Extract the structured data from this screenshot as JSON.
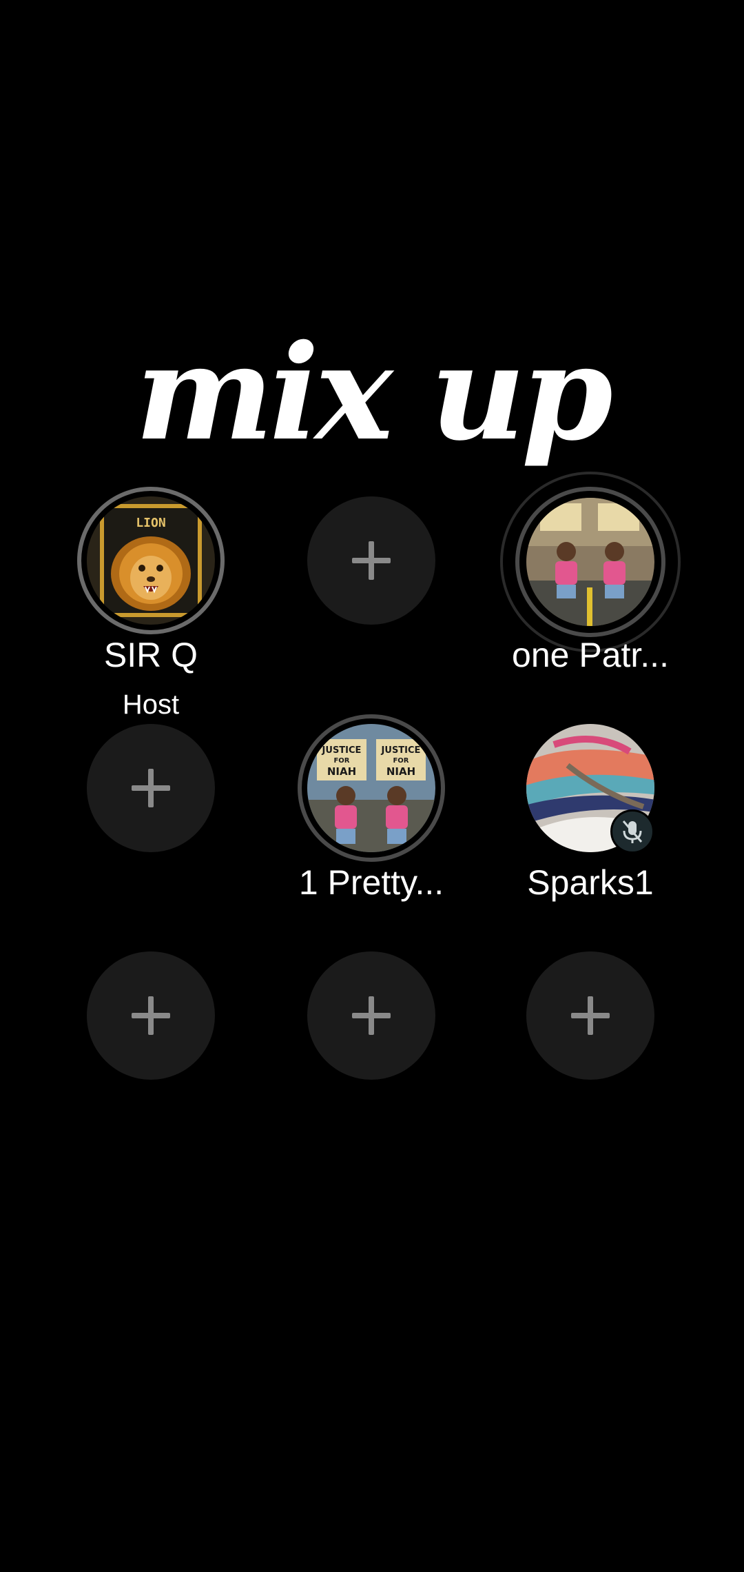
{
  "title": "mix up",
  "seats": [
    {
      "name": "SIR Q",
      "role": "Host",
      "avatar": "lion-avatar"
    },
    {
      "empty": true
    },
    {
      "name": "one Patr...",
      "avatar": "protest-photo-avatar"
    },
    {
      "empty": true
    },
    {
      "name": "1 Pretty...",
      "avatar": "justice-for-niah-avatar",
      "sign_text": "JUSTICE FOR NIAH"
    },
    {
      "name": "Sparks1",
      "avatar": "sneaker-avatar",
      "muted": true
    },
    {
      "empty": true
    },
    {
      "empty": true
    },
    {
      "empty": true
    }
  ],
  "lion_logo_text": "LION",
  "icons": {
    "add": "plus-icon",
    "muted": "mic-off-icon"
  },
  "colors": {
    "background": "#000000",
    "empty_seat": "#1b1b1b",
    "plus": "#8a8a8a",
    "text": "#ffffff"
  }
}
